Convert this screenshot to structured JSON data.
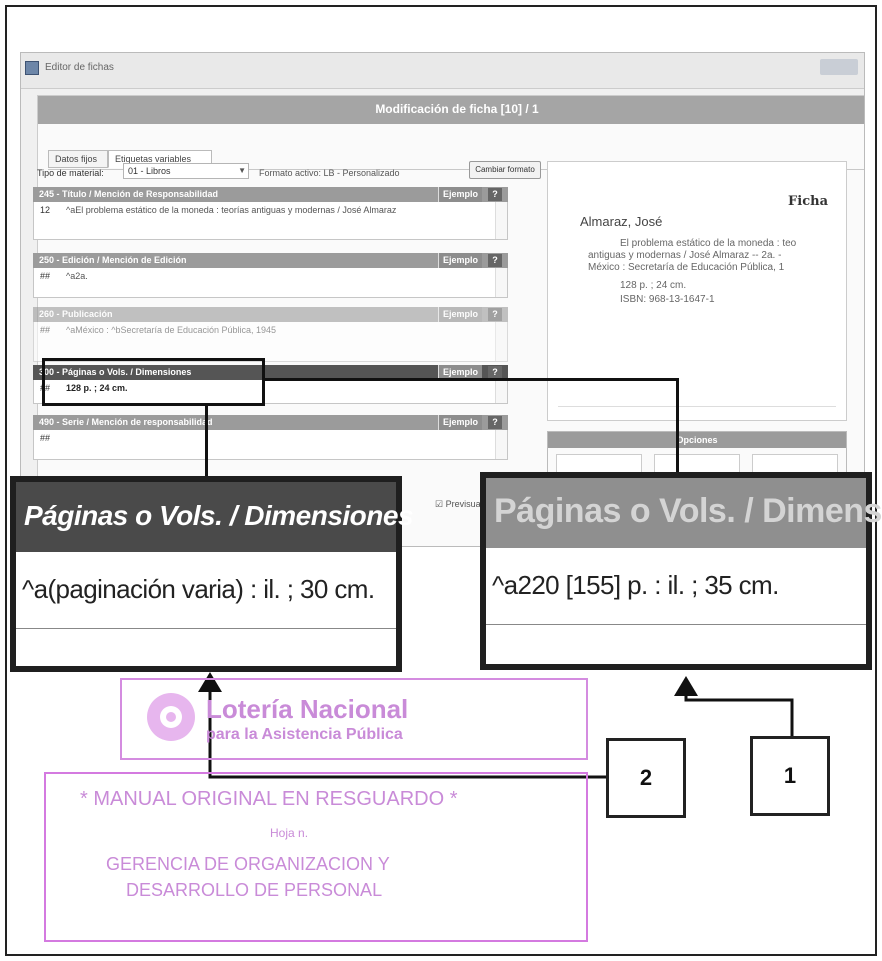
{
  "window": {
    "title": "Editor de fichas"
  },
  "panel": {
    "title": "Modificación de ficha [10] / 1"
  },
  "tabs": [
    {
      "label": "Datos fijos"
    },
    {
      "label": "Etiquetas variables"
    }
  ],
  "material": {
    "label": "Tipo de material:",
    "value": "01 - Libros",
    "format_label": "Formato activo: LB - Personalizado",
    "change_button": "Cambiar formato"
  },
  "fields": [
    {
      "head": "245 - Título / Mención de Responsabilidad",
      "ind": "12",
      "value": "^aEl problema estático de la moneda : teorías antiguas y modernas / José Almaraz",
      "ejemplo": "Ejemplo",
      "help": "?"
    },
    {
      "head": "250 - Edición / Mención de Edición",
      "ind": "##",
      "value": "^a2a.",
      "ejemplo": "Ejemplo",
      "help": "?"
    },
    {
      "head": "260 - Publicación",
      "ind": "##",
      "value": "^aMéxico : ^bSecretaría de Educación Pública, 1945",
      "ejemplo": "Ejemplo",
      "help": "?"
    },
    {
      "head": "300 - Páginas o Vols. / Dimensiones",
      "ind": "##",
      "value": "128 p. ; 24 cm.",
      "ejemplo": "Ejemplo",
      "help": "?"
    },
    {
      "head": "490 - Serie / Mención de responsabilidad",
      "ind": "##",
      "value": "",
      "ejemplo": "Ejemplo",
      "help": "?"
    }
  ],
  "ficha": {
    "title": "Ficha",
    "author": "Almaraz, José",
    "lines": [
      "El problema estático de la moneda : teo",
      "antiguas y modernas / José Almaraz -- 2a. -",
      "México : Secretaría de Educación Pública, 1",
      "128 p. ; 24 cm.",
      "ISBN: 968-13-1647-1"
    ]
  },
  "opciones": {
    "title": "Opciones"
  },
  "previsualizar": "Previsualizar",
  "zoom_left": {
    "title": "Páginas o Vols. / Dimensiones",
    "value": "^a(paginación varia) : il. ; 30 cm."
  },
  "zoom_right": {
    "title": "Páginas o Vols. / Dimensi",
    "value": "^a220 [155] p. : il. ; 35 cm."
  },
  "callouts": {
    "one": "1",
    "two": "2"
  },
  "stamp": {
    "org_line1": "Lotería Nacional",
    "org_line2": "para la Asistencia Pública",
    "manual": "* MANUAL ORIGINAL EN RESGUARDO *",
    "hoja": "Hoja n.",
    "gerencia1": "GERENCIA DE ORGANIZACION Y",
    "gerencia2": "DESARROLLO DE PERSONAL"
  },
  "colors": {
    "stamp": "#d47ae0",
    "highlight": "#111111"
  }
}
